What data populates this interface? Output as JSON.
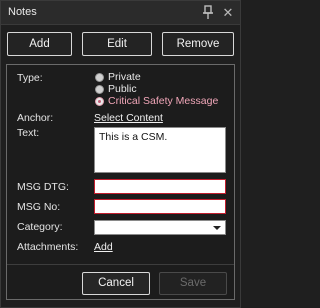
{
  "window": {
    "title": "Notes",
    "pin_icon": "pin-icon",
    "close_icon": "close-icon"
  },
  "toolbar": {
    "add_label": "Add",
    "edit_label": "Edit",
    "remove_label": "Remove"
  },
  "form": {
    "type_label": "Type:",
    "type_options": [
      {
        "label": "Private",
        "selected": false
      },
      {
        "label": "Public",
        "selected": false
      },
      {
        "label": "Critical Safety Message",
        "selected": true
      }
    ],
    "anchor_label": "Anchor:",
    "anchor_link": "Select Content",
    "text_label": "Text:",
    "text_value": "This is a CSM.",
    "msg_dtg_label": "MSG DTG:",
    "msg_dtg_value": "",
    "msg_no_label": "MSG No:",
    "msg_no_value": "",
    "category_label": "Category:",
    "category_value": "",
    "attachments_label": "Attachments:",
    "attachments_link": "Add"
  },
  "footer": {
    "cancel_label": "Cancel",
    "save_label": "Save"
  },
  "colors": {
    "background": "#1f1f1f",
    "selected_option": "#f0a6b8",
    "required_border": "#c21e2e",
    "disabled_text": "#6b6b6b"
  }
}
